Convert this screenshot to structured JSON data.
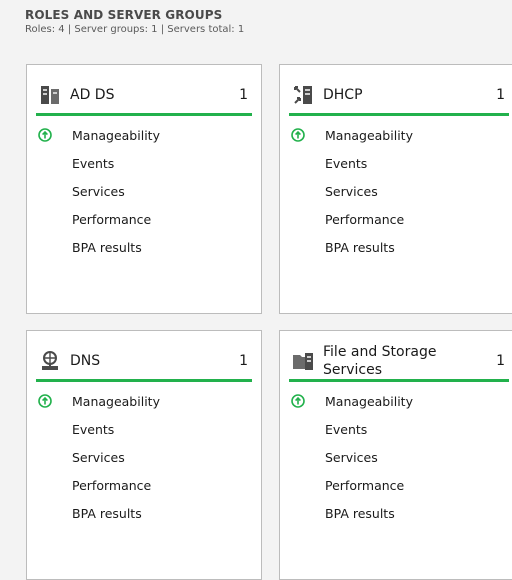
{
  "header": {
    "title": "ROLES AND SERVER GROUPS",
    "subtitle": "Roles: 4  |  Server groups: 1  |  Servers total: 1"
  },
  "tiles": [
    {
      "name": "AD DS",
      "count": "1",
      "icon": "ad-ds-icon",
      "items": [
        "Manageability",
        "Events",
        "Services",
        "Performance",
        "BPA results"
      ]
    },
    {
      "name": "DHCP",
      "count": "1",
      "icon": "dhcp-icon",
      "items": [
        "Manageability",
        "Events",
        "Services",
        "Performance",
        "BPA results"
      ]
    },
    {
      "name": "DNS",
      "count": "1",
      "icon": "dns-icon",
      "items": [
        "Manageability",
        "Events",
        "Services",
        "Performance",
        "BPA results"
      ]
    },
    {
      "name": "File and Storage Services",
      "count": "1",
      "icon": "file-storage-icon",
      "items": [
        "Manageability",
        "Events",
        "Services",
        "Performance",
        "BPA results"
      ]
    }
  ],
  "colors": {
    "accent": "#22b14c",
    "border": "#bcbcbc",
    "background": "#f3f3f3"
  }
}
